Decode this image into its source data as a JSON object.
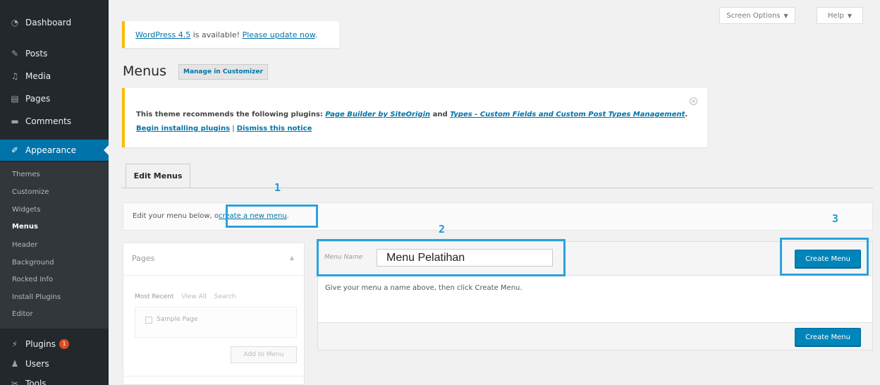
{
  "sidebar": {
    "items": [
      {
        "label": "Dashboard",
        "icon": "dashboard-icon"
      },
      {
        "label": "Posts",
        "icon": "pin-icon"
      },
      {
        "label": "Media",
        "icon": "media-icon"
      },
      {
        "label": "Pages",
        "icon": "pages-icon"
      },
      {
        "label": "Comments",
        "icon": "comment-icon"
      },
      {
        "label": "Appearance",
        "icon": "brush-icon"
      }
    ],
    "submenu": [
      "Themes",
      "Customize",
      "Widgets",
      "Menus",
      "Header",
      "Background",
      "Rocked Info",
      "Install Plugins",
      "Editor"
    ],
    "lower_items": [
      {
        "label": "Plugins",
        "badge": "1",
        "icon": "plugin-icon"
      },
      {
        "label": "Users",
        "icon": "users-icon"
      },
      {
        "label": "Tools",
        "icon": "tools-icon"
      }
    ]
  },
  "top_buttons": {
    "screen_options": "Screen Options",
    "help": "Help"
  },
  "update_notice": {
    "link1": "WordPress 4.5",
    "middle": " is available! ",
    "link2": "Please update now",
    "end": "."
  },
  "page": {
    "title": "Menus",
    "customizer_button": "Manage in Customizer"
  },
  "plugin_notice": {
    "text_prefix": "This theme recommends the following plugins: ",
    "plugin1": "Page Builder by SiteOrigin",
    "and": " and ",
    "plugin2": "Types - Custom Fields and Custom Post Types Management",
    "end": ".",
    "begin_link": "Begin installing plugins",
    "sep": " | ",
    "dismiss_link": "Dismiss this notice"
  },
  "tabs": {
    "edit_menus": "Edit Menus"
  },
  "edit_bar": {
    "text": "Edit your menu below, o",
    "link": "create a new menu",
    "end": "."
  },
  "pages_box": {
    "title": "Pages",
    "tabs": [
      "Most Recent",
      "View All",
      "Search"
    ],
    "item": "Sample Page",
    "add_button": "Add to Menu"
  },
  "menu_editor": {
    "name_label": "Menu Name",
    "name_value": "Menu Pelatihan",
    "hint": "Give your menu a name above, then click Create Menu.",
    "create_button": "Create Menu"
  },
  "annotations": [
    "1",
    "2",
    "3"
  ],
  "colors": {
    "sidebar_bg": "#23282d",
    "accent": "#0073aa",
    "highlight": "#29a3dc",
    "notice_border": "#ffb900"
  }
}
